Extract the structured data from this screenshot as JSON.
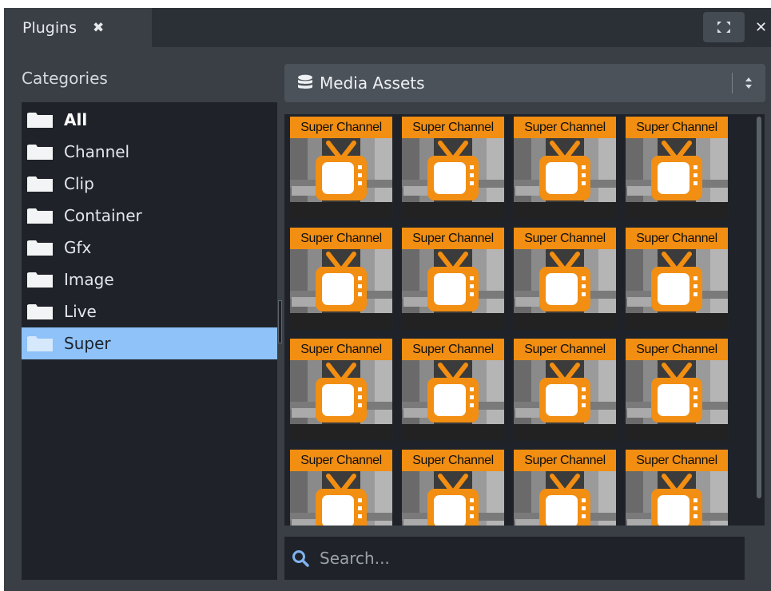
{
  "tab": {
    "label": "Plugins",
    "close_glyph": "✖"
  },
  "window_close_glyph": "✕",
  "categories": {
    "title": "Categories",
    "items": [
      {
        "label": "All",
        "bold": true,
        "selected": false
      },
      {
        "label": "Channel",
        "bold": false,
        "selected": false
      },
      {
        "label": "Clip",
        "bold": false,
        "selected": false
      },
      {
        "label": "Container",
        "bold": false,
        "selected": false
      },
      {
        "label": "Gfx",
        "bold": false,
        "selected": false
      },
      {
        "label": "Image",
        "bold": false,
        "selected": false
      },
      {
        "label": "Live",
        "bold": false,
        "selected": false
      },
      {
        "label": "Super",
        "bold": false,
        "selected": true
      }
    ]
  },
  "asset_select": {
    "label": "Media Assets",
    "icon": "database-icon"
  },
  "assets": {
    "tile_label": "Super Channel",
    "count": 16
  },
  "search": {
    "placeholder": "Search..."
  },
  "colors": {
    "accent_selected": "#8ec2f8",
    "tile_orange": "#f28e12",
    "panel_dark": "#1f2329"
  }
}
